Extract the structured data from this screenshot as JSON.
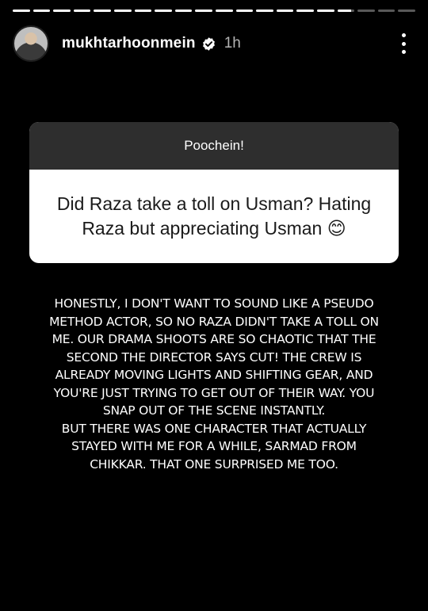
{
  "story": {
    "progress": [
      1,
      1,
      1,
      1,
      1,
      1,
      1,
      1,
      1,
      1,
      1,
      1,
      1,
      1,
      1,
      1,
      0.8,
      0,
      0,
      0
    ]
  },
  "header": {
    "username": "mukhtarhoonmein",
    "time": "1h",
    "verified_icon": "verified-badge-icon",
    "more_icon": "more-vertical-icon"
  },
  "question": {
    "title": "Poochein!",
    "text": "Did Raza take a toll on Usman? Hating Raza but appreciating Usman 😊"
  },
  "answer": {
    "text": "HONESTLY, I DON'T WANT TO SOUND LIKE A PSEUDO\nMETHOD ACTOR, SO NO RAZA DIDN'T TAKE A TOLL ON\nME. OUR DRAMA SHOOTS ARE SO CHAOTIC THAT THE\nSECOND THE DIRECTOR SAYS CUT! THE CREW IS\nALREADY MOVING LIGHTS AND SHIFTING GEAR, AND\nYOU'RE JUST TRYING TO GET OUT OF THEIR WAY. YOU\nSNAP OUT OF THE SCENE INSTANTLY.\nBUT THERE WAS ONE CHARACTER THAT ACTUALLY\nSTAYED WITH ME FOR A WHILE, SARMAD FROM\nCHIKKAR. THAT ONE SURPRISED ME TOO."
  },
  "colors": {
    "background": "#000000",
    "card_header": "#2e2e2e",
    "card_body": "#ffffff",
    "verified": "#ffffff"
  }
}
